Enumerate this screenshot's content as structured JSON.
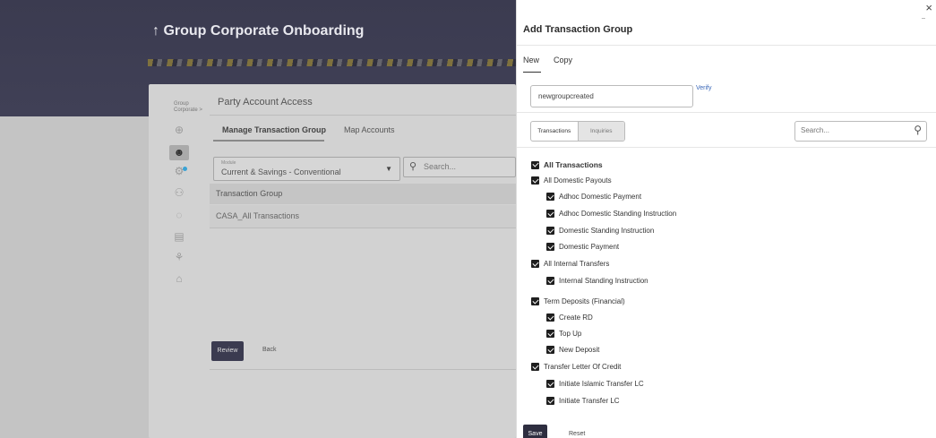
{
  "background": {
    "page_title": "↑ Group Corporate Onboarding",
    "breadcrumb_line1": "Group",
    "breadcrumb_line2": "Corporate >",
    "card_title": "Party Account Access",
    "tabs": [
      "Manage Transaction Group",
      "Map Accounts"
    ],
    "module_label": "Module",
    "module_value": "Current & Savings - Conventional",
    "search_placeholder": "Search...",
    "table_header": "Transaction Group",
    "rows": [
      "CASA_All Transactions"
    ],
    "review_label": "Review",
    "back_label": "Back"
  },
  "drawer": {
    "title": "Add Transaction Group",
    "close": "×",
    "tabs": [
      "New",
      "Copy"
    ],
    "group_name_value": "newgroupcreated",
    "verify_label": "Verify",
    "segment": [
      "Transactions",
      "Inquiries"
    ],
    "search_placeholder": "Search...",
    "tree": {
      "root": "All Transactions",
      "groups": [
        {
          "label": "All Domestic Payouts",
          "children": [
            "Adhoc Domestic Payment",
            "Adhoc Domestic Standing Instruction",
            "Domestic Standing Instruction",
            "Domestic Payment"
          ]
        },
        {
          "label": "All Internal Transfers",
          "children": [
            "Internal Standing Instruction"
          ]
        },
        {
          "label": "Term Deposits (Financial)",
          "children": [
            "Create RD",
            "Top Up",
            "New Deposit"
          ]
        },
        {
          "label": "Transfer Letter Of Credit",
          "children": [
            "Initiate Islamic Transfer LC",
            "Initiate Transfer LC"
          ]
        }
      ]
    },
    "save_label": "Save",
    "reset_label": "Reset"
  }
}
